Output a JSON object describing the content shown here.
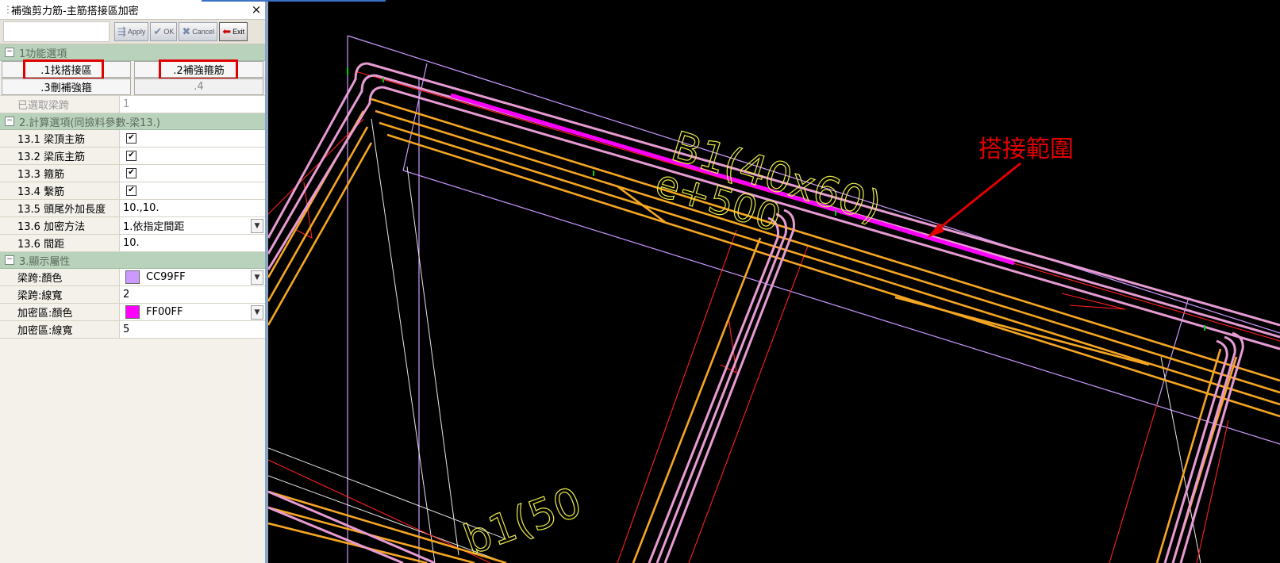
{
  "window": {
    "title": "補強剪力筋-主筋搭接區加密",
    "close": "×"
  },
  "toolbar": {
    "apply": "Apply",
    "ok": "OK",
    "cancel": "Cancel",
    "exit": "Exit"
  },
  "section1": {
    "label": "1功能選項",
    "buttons": [
      ".1找搭接區",
      ".2補強箍筋",
      ".3刪補強箍",
      ".4"
    ],
    "selected_label": "已選取梁跨",
    "selected_value": "1"
  },
  "section2": {
    "label": "2.計算選項(同撿料參數-梁13.)",
    "rows": [
      {
        "label": "13.1 梁頂主筋",
        "value": "✔"
      },
      {
        "label": "13.2 梁底主筋",
        "value": "✔"
      },
      {
        "label": "13.3 箍筋",
        "value": "✔"
      },
      {
        "label": "13.4 繫筋",
        "value": "✔"
      },
      {
        "label": "13.5 頭尾外加長度",
        "value": "10.,10."
      },
      {
        "label": "13.6 加密方法",
        "value": "1.依指定間距"
      },
      {
        "label": "13.6 間距",
        "value": "10."
      }
    ]
  },
  "section3": {
    "label": "3.顯示屬性",
    "rows": [
      {
        "label": "梁跨:顏色",
        "value": "CC99FF",
        "color": "#CC99FF"
      },
      {
        "label": "梁跨:線寬",
        "value": "2"
      },
      {
        "label": "加密區:顏色",
        "value": "FF00FF",
        "color": "#FF00FF"
      },
      {
        "label": "加密區:線寬",
        "value": "5"
      }
    ]
  },
  "viewport": {
    "annotation": "搭接範圍",
    "beam_label_1": "B1(40x60)",
    "beam_label_2": "e+500",
    "beam_label_3": "b1(50",
    "colors": {
      "beam": "#CC99FF",
      "rebar_pink": "#e79bd3",
      "rebar_orange": "#f5a623",
      "dense": "#FF00FF",
      "annotation": "#e00000",
      "label": "#e8e84a"
    }
  }
}
